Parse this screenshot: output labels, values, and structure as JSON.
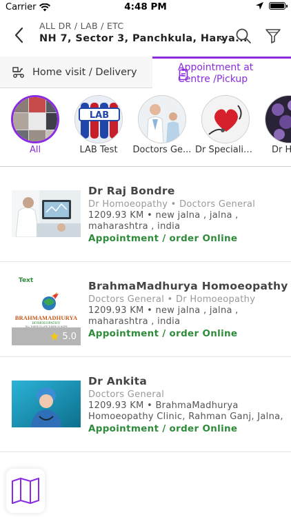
{
  "status_bar": {
    "carrier": "Carrier",
    "time": "4:48 PM",
    "icons": [
      "wifi-icon",
      "location-arrow-icon",
      "battery-icon"
    ]
  },
  "header": {
    "subtitle": "ALL DR / LAB / ETC",
    "location": "NH 7, Sector 3, Panchkula, Harya...",
    "icons": [
      "back-arrow-icon",
      "chevron-down-icon",
      "search-icon",
      "filter-icon"
    ]
  },
  "tabs": {
    "home_visit": "Home visit / Delivery",
    "appointment_line1": "Appointment at",
    "appointment_line2": "Centre /Pickup",
    "active": "appointment"
  },
  "categories": [
    {
      "label": "All",
      "active": true
    },
    {
      "label": "LAB Test",
      "active": false
    },
    {
      "label": "Doctors Ge...",
      "active": false
    },
    {
      "label": "Dr Specialists",
      "active": false
    },
    {
      "label": "Dr Hom",
      "active": false
    }
  ],
  "listings": [
    {
      "name": "Dr Raj Bondre",
      "categories": "Dr Homoeopathy • Doctors General",
      "address_line1": "1209.93 KM • new jalna , jalna ,",
      "address_line2": "maharashtra , india",
      "cta": "Appointment / order Online",
      "rating": null
    },
    {
      "name": "BrahmaMadhurya Homoeopathy",
      "categories": "Doctors General • Dr Homoeopathy",
      "address_line1": "1209.93 KM • new jalna , jalna ,",
      "address_line2": "maharashtra , india",
      "cta": "Appointment / order Online",
      "rating": "5.0",
      "thumb_text_top": "Text",
      "logo_text": "BRAHMAMADHURYA",
      "logo_sub": "HOMOEOPATHY",
      "logo_tagline": "TILL THERE IS LIFE THERE IS HOPE"
    },
    {
      "name": "Dr Ankita",
      "categories": "Doctors General",
      "address_line1": "1209.93 KM • BrahmaMadhurya",
      "address_line2": "Homoeopathy Clinic, Rahman Ganj, Jalna,",
      "cta": "Appointment / order Online",
      "rating": null
    }
  ],
  "colors": {
    "accent": "#8a2be2",
    "cta_green": "#2e8b3a",
    "muted_text": "#999999"
  },
  "fab": {
    "icon": "map-icon"
  }
}
